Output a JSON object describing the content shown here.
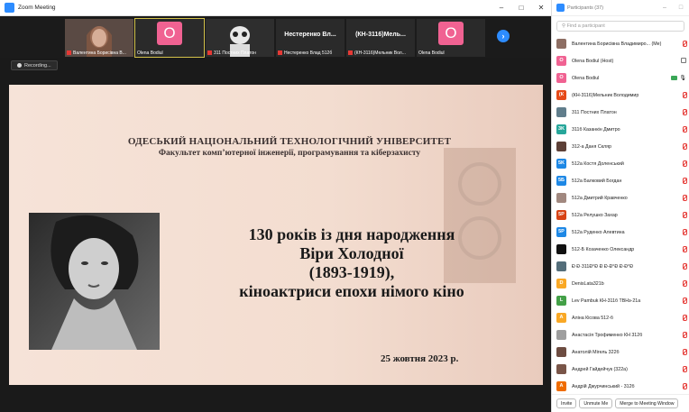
{
  "window": {
    "title": "Zoom Meeting",
    "minimize": "–",
    "maximize": "□",
    "close": "✕"
  },
  "strip": {
    "tiles": [
      {
        "caption": "Валентина Борисівна В..."
      },
      {
        "caption": "Olena Bodiul",
        "initial": "O"
      },
      {
        "caption": "311 Постних Платон"
      },
      {
        "big": "Нестеренко Вл...",
        "caption": "Нестеренко Влад 512б"
      },
      {
        "big": "(КН-3116)Мель...",
        "caption": "(КН-3116)Мельник Вол..."
      },
      {
        "caption": "Olena Bodiul",
        "initial": "O"
      }
    ],
    "next": "›"
  },
  "recording": "Recording...",
  "slide": {
    "university": "ОДЕСЬКИЙ НАЦІОНАЛЬНИЙ ТЕХНОЛОГІЧНИЙ УНІВЕРСИТЕТ",
    "faculty": "Факультет комп’ютерної інженерії, програмування та кіберзахисту",
    "line1": "130 років із дня народження",
    "line2": "Віри Холодної",
    "line3": "(1893-1919),",
    "line4": "кіноактриси епохи німого кіно",
    "date": "25 жовтня 2023 р."
  },
  "panel": {
    "title": "Participants (37)",
    "minimize": "–",
    "maximize": "□",
    "search_placeholder": "Find a participant",
    "participants": [
      {
        "name": "Валентина Борисівна Владимиро... (Me)",
        "avatar": "",
        "color": "#8d6e63",
        "mic": "muted",
        "cam": ""
      },
      {
        "name": "Olena Bodiul (Host)",
        "avatar": "O",
        "color": "#f06292",
        "mic": "",
        "cam": "off"
      },
      {
        "name": "Olena Bodiul",
        "avatar": "O",
        "color": "#f06292",
        "mic": "on",
        "cam": "on"
      },
      {
        "name": "(КН-3116)Мельник Володимир",
        "avatar": "(К",
        "color": "#e64a19",
        "mic": "muted",
        "cam": ""
      },
      {
        "name": "311 Постних Платон",
        "avatar": "",
        "color": "#607d8b",
        "mic": "muted",
        "cam": ""
      },
      {
        "name": "311б Казанкін Дмитро",
        "avatar": "3K",
        "color": "#26a69a",
        "mic": "muted",
        "cam": ""
      },
      {
        "name": "312-а Даня Скляр",
        "avatar": "",
        "color": "#5d4037",
        "mic": "muted",
        "cam": ""
      },
      {
        "name": "512а Костя Доленський",
        "avatar": "5K",
        "color": "#1e88e5",
        "mic": "muted",
        "cam": ""
      },
      {
        "name": "512а Балковий Богдан",
        "avatar": "5Б",
        "color": "#1e88e5",
        "mic": "muted",
        "cam": ""
      },
      {
        "name": "512а Дмитрий Кравченко",
        "avatar": "",
        "color": "#a1887f",
        "mic": "muted",
        "cam": ""
      },
      {
        "name": "512а Релушко Захар",
        "avatar": "5P",
        "color": "#d84315",
        "mic": "muted",
        "cam": ""
      },
      {
        "name": "512а Руденко Алевтина",
        "avatar": "5P",
        "color": "#1e88e5",
        "mic": "muted",
        "cam": ""
      },
      {
        "name": "512-Б Козаченко Олександр",
        "avatar": "",
        "color": "#111111",
        "mic": "muted",
        "cam": ""
      },
      {
        "name": "Ð Ð·311Ð°Ð Ð Ð·Ð°Ð Ð·Ð°Ð",
        "avatar": "",
        "color": "#546e7a",
        "mic": "muted",
        "cam": ""
      },
      {
        "name": "DenisLata321b",
        "avatar": "D",
        "color": "#f9a825",
        "mic": "muted",
        "cam": ""
      },
      {
        "name": "Lev Pambuk КН-311б ТВНз-21а",
        "avatar": "L",
        "color": "#43a047",
        "mic": "muted",
        "cam": ""
      },
      {
        "name": "Аліна Кісова 512-б",
        "avatar": "A",
        "color": "#f9a825",
        "mic": "muted",
        "cam": ""
      },
      {
        "name": "Анастасія Трофименко КН 312б",
        "avatar": "",
        "color": "#9e9e9e",
        "mic": "muted",
        "cam": ""
      },
      {
        "name": "Анатолій Мігель 322б",
        "avatar": "",
        "color": "#6d4c41",
        "mic": "muted",
        "cam": ""
      },
      {
        "name": "Андрей Гайдейчук (322а)",
        "avatar": "",
        "color": "#795548",
        "mic": "muted",
        "cam": ""
      },
      {
        "name": "Андрій Джурчинський - 312б",
        "avatar": "A",
        "color": "#ef6c00",
        "mic": "muted",
        "cam": ""
      },
      {
        "name": "Аріна Крошкіна ЕМ-274",
        "avatar": "",
        "color": "#111111",
        "mic": "muted",
        "cam": ""
      }
    ],
    "invite": "Invite",
    "unmute": "Unmute Me",
    "merge": "Merge to Meeting Window"
  }
}
